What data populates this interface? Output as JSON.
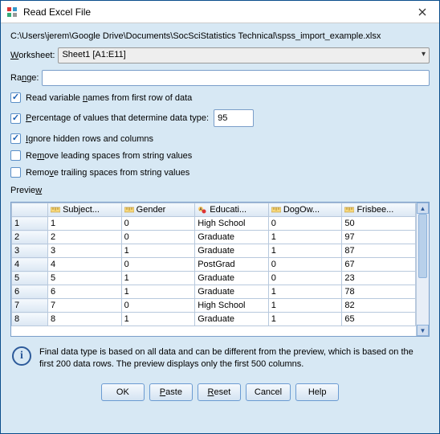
{
  "window": {
    "title": "Read Excel File"
  },
  "filepath": "C:\\Users\\jerem\\Google Drive\\Documents\\SocSciStatistics Technical\\spss_import_example.xlsx",
  "worksheet": {
    "label_pre": "",
    "label_u": "W",
    "label_post": "orksheet:",
    "value": "Sheet1 [A1:E11]"
  },
  "range": {
    "label_pre": "Ra",
    "label_u": "n",
    "label_post": "ge:",
    "value": ""
  },
  "options": {
    "read_names": {
      "checked": true,
      "pre": "Read variable ",
      "u": "n",
      "post": "ames from first row of data"
    },
    "pct_type": {
      "checked": true,
      "pre": "",
      "u": "P",
      "post": "ercentage of values that determine data type:",
      "value": "95"
    },
    "ignore_hidden": {
      "checked": true,
      "pre": "",
      "u": "I",
      "post": "gnore hidden rows and columns"
    },
    "remove_leading": {
      "checked": false,
      "pre": "Re",
      "u": "m",
      "post": "ove leading spaces from string values"
    },
    "remove_trailing": {
      "checked": false,
      "pre": "Remo",
      "u": "v",
      "post": "e trailing spaces from string values"
    }
  },
  "preview": {
    "label_pre": "Previe",
    "label_u": "w",
    "headers": [
      "Subject...",
      "Gender",
      "Educati...",
      "DogOw...",
      "Frisbee..."
    ],
    "header_types": [
      "num",
      "num",
      "str",
      "num",
      "num"
    ],
    "rows": [
      [
        "1",
        "1",
        "0",
        "High School",
        "0",
        "50"
      ],
      [
        "2",
        "2",
        "0",
        "Graduate",
        "1",
        "97"
      ],
      [
        "3",
        "3",
        "1",
        "Graduate",
        "1",
        "87"
      ],
      [
        "4",
        "4",
        "0",
        "PostGrad",
        "0",
        "67"
      ],
      [
        "5",
        "5",
        "1",
        "Graduate",
        "0",
        "23"
      ],
      [
        "6",
        "6",
        "1",
        "Graduate",
        "1",
        "78"
      ],
      [
        "7",
        "7",
        "0",
        "High School",
        "1",
        "82"
      ],
      [
        "8",
        "8",
        "1",
        "Graduate",
        "1",
        "65"
      ]
    ]
  },
  "note": "Final data type is based on all data and can be different from the preview, which is based on the first 200 data rows. The preview displays only the first 500 columns.",
  "buttons": {
    "ok": "OK",
    "paste": "Paste",
    "reset": "Reset",
    "cancel": "Cancel",
    "help": "Help"
  }
}
